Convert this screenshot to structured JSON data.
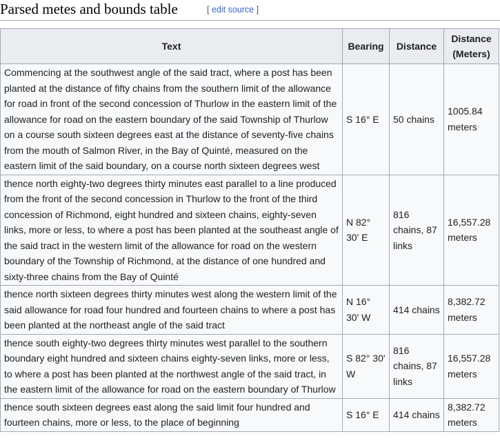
{
  "heading": {
    "title": "Parsed metes and bounds table",
    "edit_open": "[",
    "edit_label": "edit source",
    "edit_close": "]"
  },
  "table": {
    "headers": {
      "text": "Text",
      "bearing": "Bearing",
      "distance": "Distance",
      "distance_meters_line1": "Distance",
      "distance_meters_line2": "(Meters)"
    },
    "rows": [
      {
        "text": "Commencing at the southwest angle of the said tract, where a post has been planted at the distance of fifty chains from the southern limit of the allowance for road in front of the second concession of Thurlow in the eastern limit of the allowance for road on the eastern boundary of the said Township of Thurlow on a course south sixteen degrees east at the distance of seventy-five chains from the mouth of Salmon River, in the Bay of Quinté, measured on the eastern limit of the said boundary, on a course north sixteen degrees west",
        "bearing": "S 16° E",
        "distance": "50 chains",
        "meters": "1005.84 meters"
      },
      {
        "text": "thence north eighty-two degrees thirty minutes east parallel to a line produced from the front of the second concession in Thurlow to the front of the third concession of Richmond, eight hundred and sixteen chains, eighty-seven links, more or less, to where a post has been planted at the southeast angle of the said tract in the western limit of the allowance for road on the western boundary of the Township of Richmond, at the distance of one hundred and sixty-three chains from the Bay of Quinté",
        "bearing": "N 82° 30' E",
        "distance": "816 chains, 87 links",
        "meters": "16,557.28 meters"
      },
      {
        "text": "thence north sixteen degrees thirty minutes west along the western limit of the said allowance for road four hundred and fourteen chains to where a post has been planted at the northeast angle of the said tract",
        "bearing": "N 16° 30' W",
        "distance": "414 chains",
        "meters": "8,382.72 meters"
      },
      {
        "text": "thence south eighty-two degrees thirty minutes west parallel to the southern boundary eight hundred and sixteen chains eighty-seven links, more or less, to where a post has been planted at the northwest angle of the said tract, in the eastern limit of the allowance for road on the eastern boundary of Thurlow",
        "bearing": "S 82° 30' W",
        "distance": "816 chains, 87 links",
        "meters": "16,557.28 meters"
      },
      {
        "text": "thence south sixteen degrees east along the said limit four hundred and fourteen chains, more or less, to the place of beginning",
        "bearing": "S 16° E",
        "distance": "414 chains",
        "meters": "8,382.72 meters"
      }
    ]
  }
}
